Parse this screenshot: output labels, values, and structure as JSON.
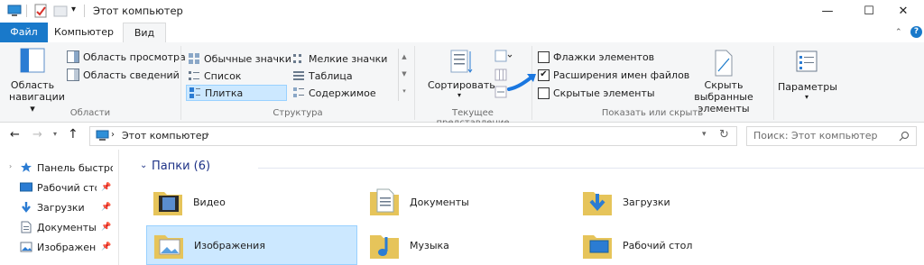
{
  "window": {
    "title": "Этот компьютер",
    "controls": {
      "minimize": "—",
      "maximize": "☐",
      "close": "✕"
    }
  },
  "tabs": [
    {
      "label": "Файл"
    },
    {
      "label": "Компьютер"
    },
    {
      "label": "Вид"
    }
  ],
  "ribbon": {
    "areas": {
      "nav_pane_label_1": "Область",
      "nav_pane_label_2": "навигации",
      "preview": "Область просмотра",
      "details": "Область сведений",
      "group": "Области"
    },
    "structure": {
      "items": [
        "Обычные значки",
        "Мелкие значки",
        "Список",
        "Таблица",
        "Плитка",
        "Содержимое"
      ],
      "group": "Структура",
      "selected": "Плитка"
    },
    "current_view": {
      "sort": "Сортировать",
      "group": "Текущее представление"
    },
    "show_hide": {
      "item_checkboxes": {
        "label": "Флажки элементов",
        "checked": false
      },
      "file_extensions": {
        "label": "Расширения имен файлов",
        "checked": true
      },
      "hidden_items": {
        "label": "Скрытые элементы",
        "checked": false
      },
      "hide_selected_1": "Скрыть выбранные",
      "hide_selected_2": "элементы",
      "group": "Показать или скрыть"
    },
    "options": {
      "label": "Параметры"
    }
  },
  "address": {
    "path": "Этот компьютер",
    "search_placeholder": "Поиск: Этот компьютер"
  },
  "nav_pane": {
    "items": [
      {
        "label": "Панель быстрого доступа",
        "icon": "star-icon"
      },
      {
        "label": "Рабочий сто...",
        "icon": "desktop-icon"
      },
      {
        "label": "Загрузки",
        "icon": "download-icon"
      },
      {
        "label": "Документы",
        "icon": "document-icon"
      },
      {
        "label": "Изображени...",
        "icon": "image-icon"
      }
    ]
  },
  "content": {
    "section_title": "Папки (6)",
    "folders": [
      {
        "label": "Видео",
        "icon": "video-folder-icon"
      },
      {
        "label": "Документы",
        "icon": "documents-folder-icon"
      },
      {
        "label": "Загрузки",
        "icon": "downloads-folder-icon"
      },
      {
        "label": "Изображения",
        "icon": "pictures-folder-icon",
        "selected": true
      },
      {
        "label": "Музыка",
        "icon": "music-folder-icon"
      },
      {
        "label": "Рабочий стол",
        "icon": "desktop-folder-icon"
      }
    ]
  },
  "colors": {
    "accent": "#1979ca",
    "selection": "#cce8ff",
    "ribbon_bg": "#f5f6f7"
  }
}
